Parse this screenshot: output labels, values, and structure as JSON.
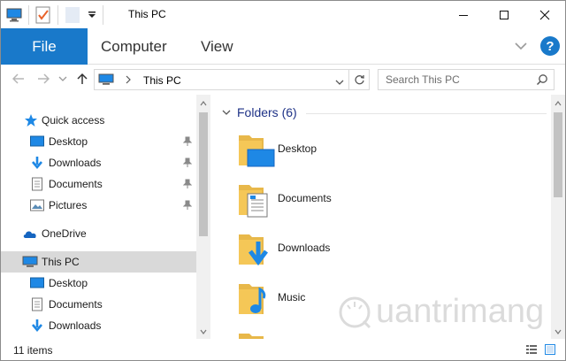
{
  "window": {
    "title": "This PC"
  },
  "ribbon": {
    "file_tab": "File",
    "tabs": [
      "Computer",
      "View"
    ]
  },
  "address": {
    "path_segment": "This PC"
  },
  "search": {
    "placeholder": "Search This PC"
  },
  "nav": {
    "quick_access": "Quick access",
    "quick_items": [
      "Desktop",
      "Downloads",
      "Documents",
      "Pictures"
    ],
    "onedrive": "OneDrive",
    "thispc": "This PC",
    "pc_items": [
      "Desktop",
      "Documents",
      "Downloads"
    ]
  },
  "content": {
    "group_title": "Folders (6)",
    "folders": [
      "Desktop",
      "Documents",
      "Downloads",
      "Music"
    ]
  },
  "watermark": {
    "text": "uantrimang"
  },
  "status": {
    "items": "11 items"
  },
  "colors": {
    "accent": "#1979ca",
    "folder": "#f5c757",
    "heading": "#1e3287"
  }
}
